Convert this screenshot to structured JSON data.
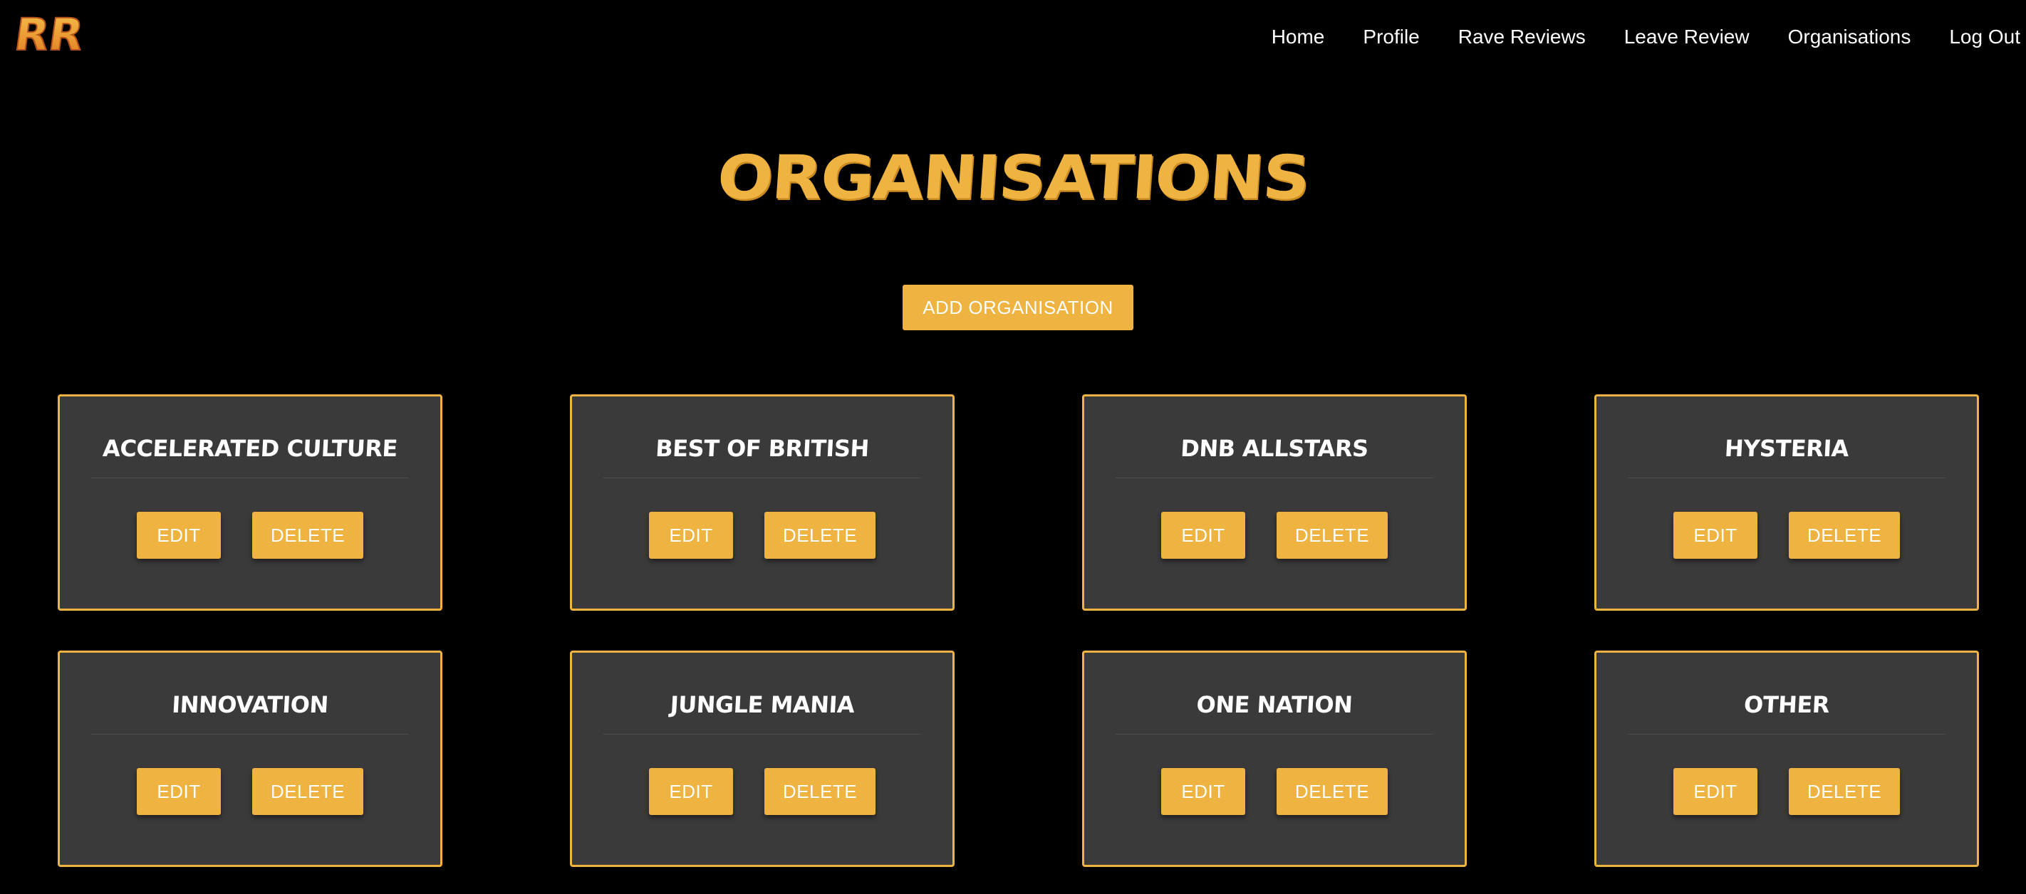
{
  "brand": {
    "logo_text": "RR",
    "accent_color": "#efb342"
  },
  "nav": {
    "items": [
      {
        "label": "Home"
      },
      {
        "label": "Profile"
      },
      {
        "label": "Rave Reviews"
      },
      {
        "label": "Leave Review"
      },
      {
        "label": "Organisations"
      },
      {
        "label": "Log Out"
      }
    ]
  },
  "page": {
    "title": "ORGANISATIONS",
    "add_button": "ADD ORGANISATION"
  },
  "organisations": [
    {
      "name": "ACCELERATED CULTURE",
      "edit": "EDIT",
      "delete": "DELETE"
    },
    {
      "name": "BEST OF BRITISH",
      "edit": "EDIT",
      "delete": "DELETE"
    },
    {
      "name": "DNB ALLSTARS",
      "edit": "EDIT",
      "delete": "DELETE"
    },
    {
      "name": "HYSTERIA",
      "edit": "EDIT",
      "delete": "DELETE"
    },
    {
      "name": "INNOVATION",
      "edit": "EDIT",
      "delete": "DELETE"
    },
    {
      "name": "JUNGLE MANIA",
      "edit": "EDIT",
      "delete": "DELETE"
    },
    {
      "name": "ONE NATION",
      "edit": "EDIT",
      "delete": "DELETE"
    },
    {
      "name": "OTHER",
      "edit": "EDIT",
      "delete": "DELETE"
    }
  ],
  "colors": {
    "background": "#000000",
    "card_background": "#3a3a3a",
    "button": "#efb342",
    "text": "#ffffff"
  }
}
